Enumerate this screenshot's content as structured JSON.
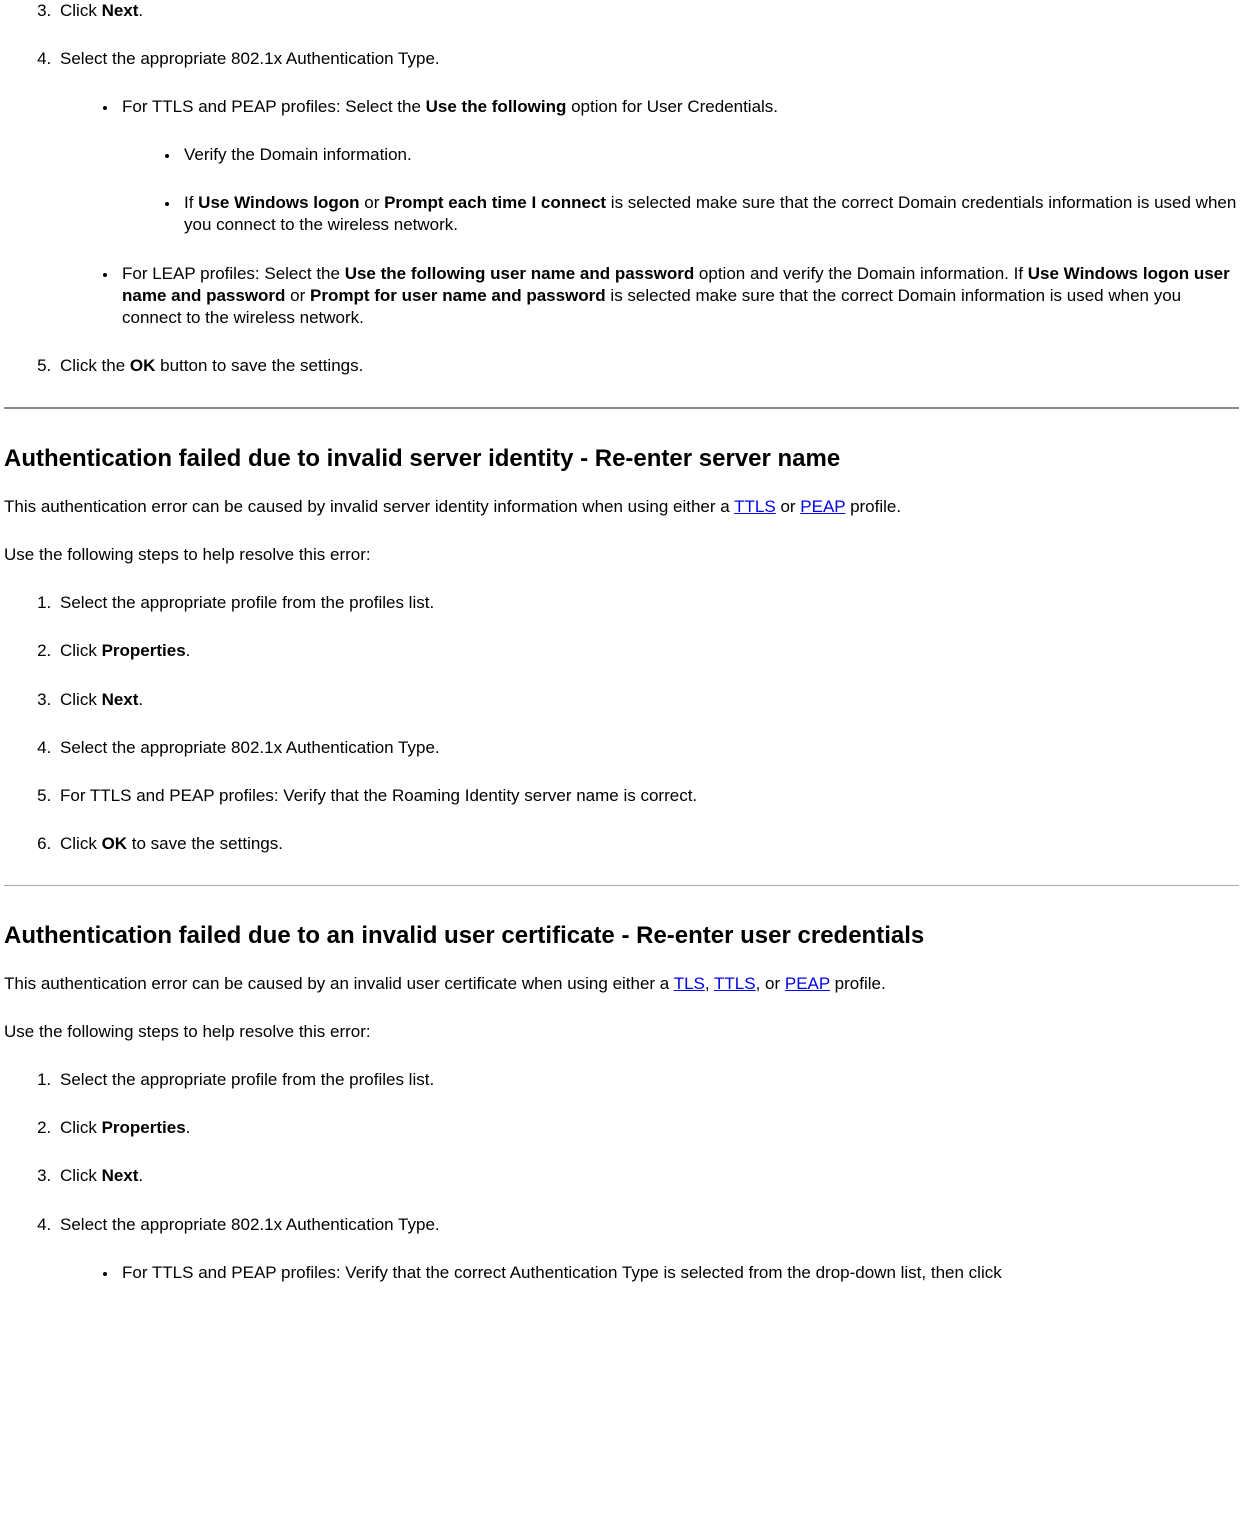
{
  "s1": {
    "ol": {
      "i3": {
        "prefix": "Click ",
        "bold": "Next",
        "suffix": "."
      },
      "i4": {
        "text": "Select the appropriate 802.1x Authentication Type.",
        "ul": {
          "a": {
            "prefix": "For TTLS and PEAP profiles: Select the ",
            "bold": "Use the following",
            "suffix": " option for User Credentials.",
            "sub": {
              "a": "Verify the Domain information.",
              "b": {
                "p1": "If ",
                "b1": "Use Windows logon",
                "p2": " or ",
                "b2": "Prompt each time I connect",
                "p3": " is selected make sure that the correct Domain credentials information is used when you connect to the wireless network."
              }
            }
          },
          "b": {
            "p1": "For LEAP profiles: Select the ",
            "b1": "Use the following user name and password",
            "p2": " option and verify the Domain information. If ",
            "b2": "Use Windows logon user name and password",
            "p3": " or ",
            "b3": "Prompt for user name and password",
            "p4": " is selected make sure that the correct Domain information is used when you connect to the wireless network."
          }
        }
      },
      "i5": {
        "prefix": "Click the ",
        "bold": "OK",
        "suffix": " button to save the settings."
      }
    }
  },
  "s2": {
    "heading": "Authentication failed due to invalid server identity - Re-enter server name",
    "intro": {
      "p1": "This authentication error can be caused by invalid server identity information when using either a ",
      "link1": "TTLS",
      "p2": " or ",
      "link2": "PEAP",
      "p3": " profile."
    },
    "lead": "Use the following steps to help resolve this error:",
    "ol": {
      "i1": "Select the appropriate profile from the profiles list.",
      "i2": {
        "prefix": "Click ",
        "bold": "Properties",
        "suffix": "."
      },
      "i3": {
        "prefix": "Click ",
        "bold": "Next",
        "suffix": "."
      },
      "i4": "Select the appropriate 802.1x Authentication Type.",
      "i5": "For TTLS and PEAP profiles: Verify that the Roaming Identity server name is correct.",
      "i6": {
        "prefix": "Click ",
        "bold": "OK",
        "suffix": " to save the settings."
      }
    }
  },
  "s3": {
    "heading": "Authentication failed due to an invalid user certificate - Re-enter user credentials",
    "intro": {
      "p1": "This authentication error can be caused by an invalid user certificate when using either a ",
      "link1": "TLS",
      "p2": ", ",
      "link2": "TTLS",
      "p3": ", or ",
      "link3": "PEAP",
      "p4": " profile."
    },
    "lead": "Use the following steps to help resolve this error:",
    "ol": {
      "i1": "Select the appropriate profile from the profiles list.",
      "i2": {
        "prefix": "Click ",
        "bold": "Properties",
        "suffix": "."
      },
      "i3": {
        "prefix": "Click ",
        "bold": "Next",
        "suffix": "."
      },
      "i4": {
        "text": "Select the appropriate 802.1x Authentication Type.",
        "ul": {
          "a": "For TTLS and PEAP profiles: Verify that the correct Authentication Type is selected from the drop-down list, then click"
        }
      }
    }
  }
}
